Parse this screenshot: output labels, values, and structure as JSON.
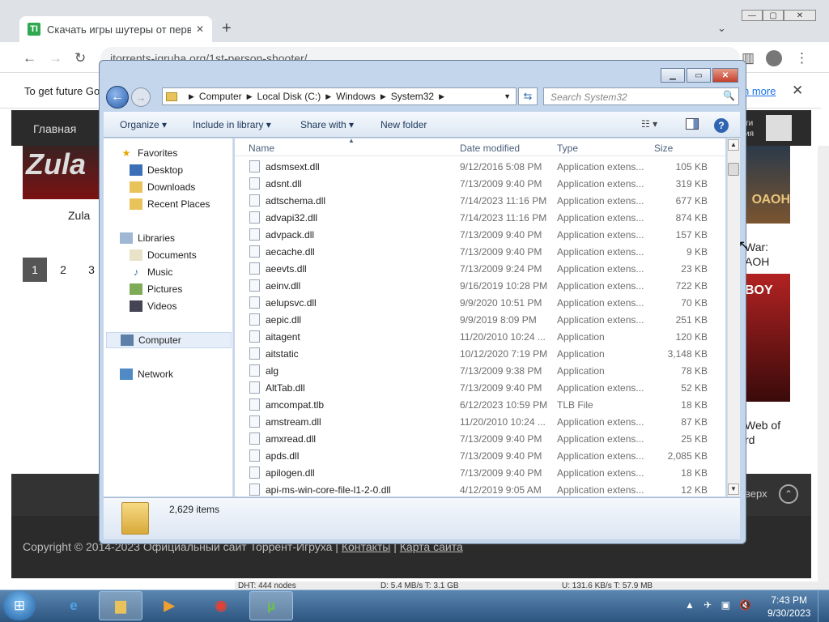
{
  "browser": {
    "tab_title": "Скачать игры шутеры от перво",
    "tab_favicon": "TI",
    "tab_close": "✕",
    "new_tab": "+",
    "tab_list": "⌄",
    "url": "itorrents-igruha.org/1st-person-shooter/",
    "window_min": "—",
    "window_max": "▢",
    "window_close": "✕"
  },
  "infobar": {
    "text": "To get future Go",
    "more": "n more",
    "close": "✕"
  },
  "site": {
    "nav_home": "Главная",
    "nav_right_text": "ти\nия",
    "zula_img_text": "Zula",
    "zula_label": "Zula",
    "pages": [
      "1",
      "2",
      "3"
    ],
    "game1_img_text": "ОАОН",
    "game1_label": "War:\nAOH",
    "game2_img_text": "BOY",
    "game2_label": "Web of\nrd",
    "footer_up": "верх",
    "footer_up_icon": "⌃",
    "copyright_plain": "Copyright © 2014-2023 Официальный сайт Торрент-Игруха | ",
    "copyright_link1": "Контакты",
    "copyright_sep": " | ",
    "copyright_link2": "Карта сайта"
  },
  "utorrent_status": {
    "dht": "DHT: 444 nodes",
    "down": "D: 5.4 MB/s T: 3.1 GB",
    "up": "U: 131.6 KB/s T: 57.9 MB"
  },
  "explorer": {
    "breadcrumb": [
      "Computer",
      "Local Disk (C:)",
      "Windows",
      "System32"
    ],
    "search_placeholder": "Search System32",
    "toolbar": {
      "organize": "Organize ▾",
      "include": "Include in library ▾",
      "share": "Share with ▾",
      "new_folder": "New folder",
      "views": "☷ ▾",
      "help": "?"
    },
    "nav": {
      "favorites": "Favorites",
      "desktop": "Desktop",
      "downloads": "Downloads",
      "recent": "Recent Places",
      "libraries": "Libraries",
      "documents": "Documents",
      "music": "Music",
      "pictures": "Pictures",
      "videos": "Videos",
      "computer": "Computer",
      "network": "Network"
    },
    "columns": {
      "name": "Name",
      "date": "Date modified",
      "type": "Type",
      "size": "Size"
    },
    "files": [
      {
        "name": "adsmsext.dll",
        "date": "9/12/2016 5:08 PM",
        "type": "Application extens...",
        "size": "105 KB"
      },
      {
        "name": "adsnt.dll",
        "date": "7/13/2009 9:40 PM",
        "type": "Application extens...",
        "size": "319 KB"
      },
      {
        "name": "adtschema.dll",
        "date": "7/14/2023 11:16 PM",
        "type": "Application extens...",
        "size": "677 KB"
      },
      {
        "name": "advapi32.dll",
        "date": "7/14/2023 11:16 PM",
        "type": "Application extens...",
        "size": "874 KB"
      },
      {
        "name": "advpack.dll",
        "date": "7/13/2009 9:40 PM",
        "type": "Application extens...",
        "size": "157 KB"
      },
      {
        "name": "aecache.dll",
        "date": "7/13/2009 9:40 PM",
        "type": "Application extens...",
        "size": "9 KB"
      },
      {
        "name": "aeevts.dll",
        "date": "7/13/2009 9:24 PM",
        "type": "Application extens...",
        "size": "23 KB"
      },
      {
        "name": "aeinv.dll",
        "date": "9/16/2019 10:28 PM",
        "type": "Application extens...",
        "size": "722 KB"
      },
      {
        "name": "aelupsvc.dll",
        "date": "9/9/2020 10:51 PM",
        "type": "Application extens...",
        "size": "70 KB"
      },
      {
        "name": "aepic.dll",
        "date": "9/9/2019 8:09 PM",
        "type": "Application extens...",
        "size": "251 KB"
      },
      {
        "name": "aitagent",
        "date": "11/20/2010 10:24 ...",
        "type": "Application",
        "size": "120 KB"
      },
      {
        "name": "aitstatic",
        "date": "10/12/2020 7:19 PM",
        "type": "Application",
        "size": "3,148 KB"
      },
      {
        "name": "alg",
        "date": "7/13/2009 9:38 PM",
        "type": "Application",
        "size": "78 KB"
      },
      {
        "name": "AltTab.dll",
        "date": "7/13/2009 9:40 PM",
        "type": "Application extens...",
        "size": "52 KB"
      },
      {
        "name": "amcompat.tlb",
        "date": "6/12/2023 10:59 PM",
        "type": "TLB File",
        "size": "18 KB"
      },
      {
        "name": "amstream.dll",
        "date": "11/20/2010 10:24 ...",
        "type": "Application extens...",
        "size": "87 KB"
      },
      {
        "name": "amxread.dll",
        "date": "7/13/2009 9:40 PM",
        "type": "Application extens...",
        "size": "25 KB"
      },
      {
        "name": "apds.dll",
        "date": "7/13/2009 9:40 PM",
        "type": "Application extens...",
        "size": "2,085 KB"
      },
      {
        "name": "apilogen.dll",
        "date": "7/13/2009 9:40 PM",
        "type": "Application extens...",
        "size": "18 KB"
      },
      {
        "name": "api-ms-win-core-file-l1-2-0.dll",
        "date": "4/12/2019 9:05 AM",
        "type": "Application extens...",
        "size": "12 KB"
      }
    ],
    "item_count": "2,629 items"
  },
  "taskbar": {
    "time": "7:43 PM",
    "date": "9/30/2023"
  }
}
